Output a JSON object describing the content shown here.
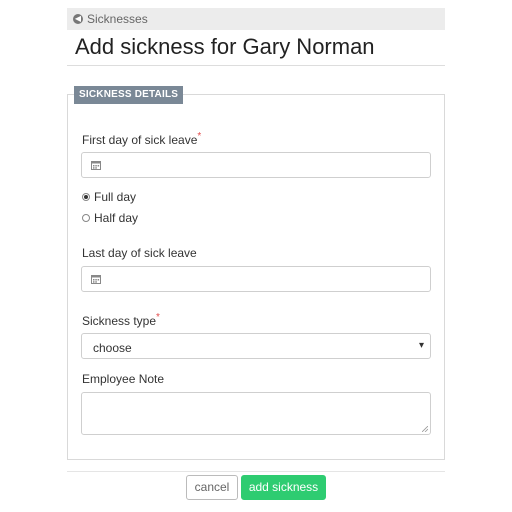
{
  "breadcrumb": {
    "label": "Sicknesses",
    "icon": "arrow-left-circle-icon"
  },
  "page": {
    "title": "Add sickness for Gary Norman"
  },
  "form": {
    "legend": "SICKNESS DETAILS",
    "first_day": {
      "label": "First day of sick leave",
      "required_marker": "*",
      "value": ""
    },
    "duration_options": [
      {
        "label": "Full day",
        "checked": true
      },
      {
        "label": "Half day",
        "checked": false
      }
    ],
    "last_day": {
      "label": "Last day of sick leave",
      "value": ""
    },
    "sickness_type": {
      "label": "Sickness type",
      "required_marker": "*",
      "selected": "choose"
    },
    "employee_note": {
      "label": "Employee Note",
      "value": ""
    }
  },
  "actions": {
    "cancel_label": "cancel",
    "submit_label": "add sickness"
  },
  "colors": {
    "accent": "#2ecc71",
    "legend_bg": "#7a8896",
    "required": "#e24c4c"
  }
}
